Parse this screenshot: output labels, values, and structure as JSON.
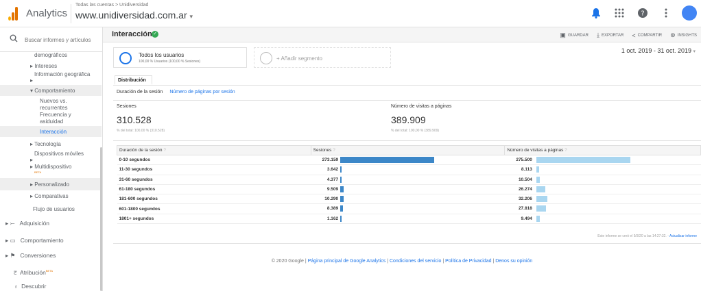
{
  "header": {
    "app_name": "Analytics",
    "breadcrumb": "Todas las cuentas > Unidiversidad",
    "property": "www.unidiversidad.com.ar",
    "dropdown_glyph": "▾"
  },
  "sidebar": {
    "search_placeholder": "Buscar informes y artículos",
    "items": {
      "demograficos": "demográficos",
      "intereses": "Intereses",
      "info_geo": "Información geográfica",
      "comportamiento": "Comportamiento",
      "nuevos": "Nuevos vs. recurrentes",
      "frecuencia": "Frecuencia y asiduidad",
      "interaccion": "Interacción",
      "tecnologia": "Tecnología",
      "dispositivos": "Dispositivos móviles",
      "multidispositivo": "Multidispositivo",
      "multidispositivo_badge": "BETA",
      "personalizado": "Personalizado",
      "comparativas": "Comparativas",
      "flujo": "Flujo de usuarios",
      "adquisicion": "Adquisición",
      "comportamiento2": "Comportamiento",
      "conversiones": "Conversiones",
      "atribucion": "Atribución",
      "atribucion_badge": "BETA",
      "descubrir": "Descubrir"
    }
  },
  "main": {
    "title": "Interacción",
    "actions": {
      "save": "GUARDAR",
      "export": "EXPORTAR",
      "share": "COMPARTIR",
      "insights": "INSIGHTS"
    },
    "segment": {
      "name": "Todos los usuarios",
      "detail": "100,00 % Usuarios (100,00 % Sesiones)",
      "add": "+ Añadir segmento"
    },
    "date_range": "1 oct. 2019 - 31 oct. 2019",
    "tab": "Distribución",
    "subtabs": {
      "active": "Duración de la sesión",
      "other": "Número de páginas por sesión"
    },
    "metrics": [
      {
        "label": "Sesiones",
        "value": "310.528",
        "sub": "% del total: 100,00 % (310.528)"
      },
      {
        "label": "Número de visitas a páginas",
        "value": "389.909",
        "sub": "% del total: 100,00 % (389.909)"
      }
    ],
    "table": {
      "headers": [
        "Duración de la sesión",
        "Sesiones",
        "Número de visitas a páginas"
      ],
      "rows": [
        {
          "label": "0-10 segundos",
          "sessions": "273.159",
          "pageviews": "275.500",
          "s_num": 273159,
          "p_num": 275500
        },
        {
          "label": "11-30 segundos",
          "sessions": "3.642",
          "pageviews": "8.113",
          "s_num": 3642,
          "p_num": 8113
        },
        {
          "label": "31-60 segundos",
          "sessions": "4.377",
          "pageviews": "10.504",
          "s_num": 4377,
          "p_num": 10504
        },
        {
          "label": "61-180 segundos",
          "sessions": "9.509",
          "pageviews": "26.274",
          "s_num": 9509,
          "p_num": 26274
        },
        {
          "label": "181-600 segundos",
          "sessions": "10.290",
          "pageviews": "32.206",
          "s_num": 10290,
          "p_num": 32206
        },
        {
          "label": "601-1800 segundos",
          "sessions": "8.389",
          "pageviews": "27.818",
          "s_num": 8389,
          "p_num": 27818
        },
        {
          "label": "1801+ segundos",
          "sessions": "1.162",
          "pageviews": "9.494",
          "s_num": 1162,
          "p_num": 9494
        }
      ]
    },
    "report_note": "Este informe se creó el 9/3/20 a las 14:27:32. -",
    "report_refresh": "Actualizar informe"
  },
  "footer": {
    "copyright": "© 2020 Google |",
    "link1": "Página principal de Google Analytics",
    "link2": "Condiciones del servicio",
    "link3": "Política de Privacidad",
    "link4": "Denos su opinión"
  },
  "colors": {
    "accent": "#1a73e8",
    "bar_sessions": "#3c87c8",
    "bar_pageviews": "#a9d6f0"
  }
}
